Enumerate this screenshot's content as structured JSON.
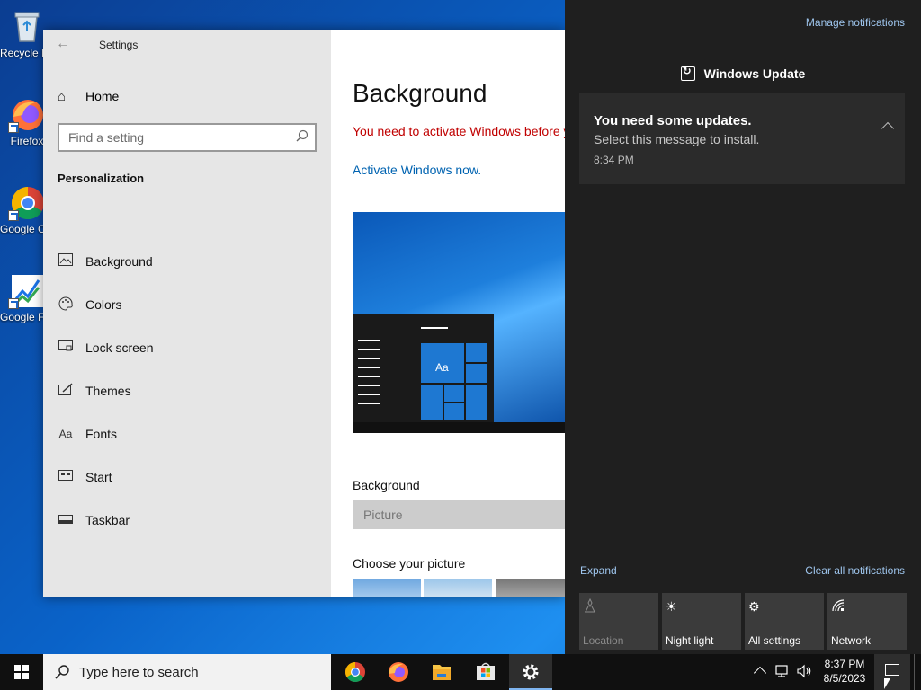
{
  "desktop": {
    "icons": [
      {
        "label": "Recycle Bin",
        "icon": "recycle-bin-icon"
      },
      {
        "label": "Firefox",
        "icon": "firefox-icon"
      },
      {
        "label": "Google Chrome",
        "icon": "chrome-icon"
      },
      {
        "label": "Google Finance",
        "icon": "finance-icon"
      }
    ]
  },
  "settings": {
    "window_title": "Settings",
    "home_label": "Home",
    "search_placeholder": "Find a setting",
    "section_title": "Personalization",
    "nav_items": [
      {
        "label": "Background",
        "icon": "picture-icon"
      },
      {
        "label": "Colors",
        "icon": "palette-icon"
      },
      {
        "label": "Lock screen",
        "icon": "lock-screen-icon"
      },
      {
        "label": "Themes",
        "icon": "brush-icon"
      },
      {
        "label": "Fonts",
        "icon": "fonts-icon"
      },
      {
        "label": "Start",
        "icon": "start-icon"
      },
      {
        "label": "Taskbar",
        "icon": "taskbar-icon"
      }
    ],
    "content": {
      "title": "Background",
      "activation_warning": "You need to activate Windows before y",
      "activate_link": "Activate Windows now.",
      "preview_tile_text": "Aa",
      "background_label": "Background",
      "background_value": "Picture",
      "choose_picture_label": "Choose your picture"
    }
  },
  "action_center": {
    "manage_notifications": "Manage notifications",
    "group_title": "Windows Update",
    "notification": {
      "title": "You need some updates.",
      "body": "Select this message to install.",
      "time": "8:34 PM"
    },
    "expand_label": "Expand",
    "clear_all_label": "Clear all notifications",
    "quick_actions": [
      {
        "label": "Location",
        "icon": "location-icon",
        "state": "off"
      },
      {
        "label": "Night light",
        "icon": "night-light-icon",
        "state": "on"
      },
      {
        "label": "All settings",
        "icon": "gear-icon",
        "state": "on"
      },
      {
        "label": "Network",
        "icon": "network-icon",
        "state": "on"
      }
    ]
  },
  "taskbar": {
    "search_placeholder": "Type here to search",
    "apps": [
      "chrome-icon",
      "firefox-icon",
      "file-explorer-icon",
      "store-icon",
      "settings-gear-icon"
    ],
    "active_app": "settings-gear-icon",
    "time": "8:37 PM",
    "date": "8/5/2023"
  },
  "colors": {
    "accent_link": "#0063b1",
    "warning": "#c00000",
    "action_center_bg": "#1f1f1f"
  }
}
